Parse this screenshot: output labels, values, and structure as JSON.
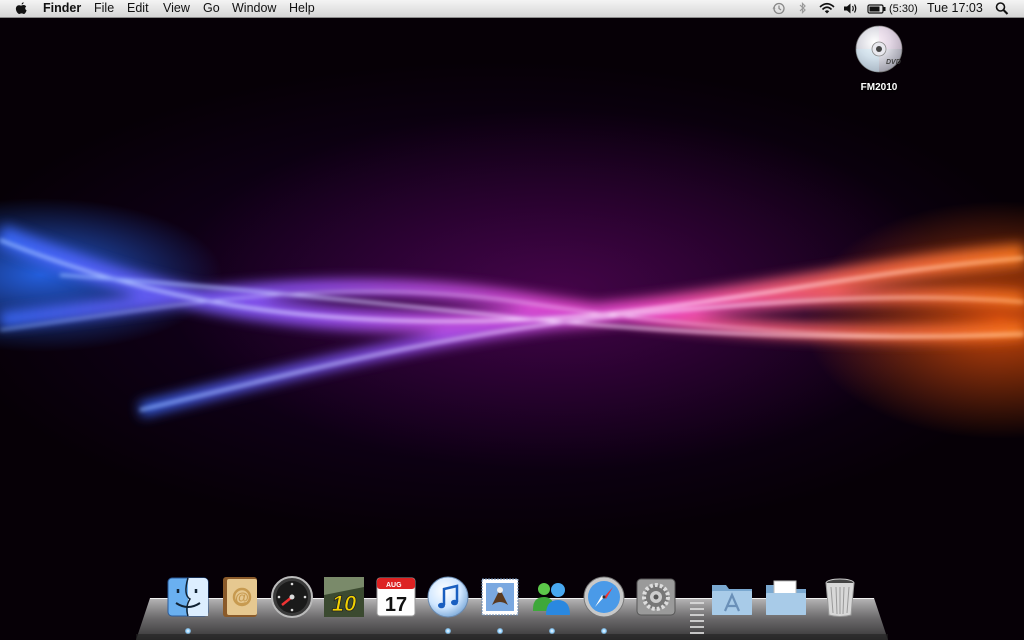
{
  "menubar": {
    "app_name": "Finder",
    "menus": [
      "File",
      "Edit",
      "View",
      "Go",
      "Window",
      "Help"
    ],
    "battery_time": "(5:30)",
    "clock": "Tue 17:03"
  },
  "desktop": {
    "disc_label": "FM2010",
    "disc_badge": "DVD"
  },
  "dock": {
    "items": [
      {
        "name": "Finder",
        "icon": "finder-icon"
      },
      {
        "name": "Address Book",
        "icon": "address-book-icon"
      },
      {
        "name": "Dashboard",
        "icon": "dashboard-icon"
      },
      {
        "name": "FM 10",
        "icon": "fm10-icon",
        "text": "10"
      },
      {
        "name": "iCal",
        "icon": "calendar-icon",
        "month": "AUG",
        "day": "17"
      },
      {
        "name": "iTunes",
        "icon": "itunes-icon"
      },
      {
        "name": "Mail",
        "icon": "mail-icon"
      },
      {
        "name": "Messenger",
        "icon": "messenger-icon"
      },
      {
        "name": "Safari",
        "icon": "safari-icon"
      },
      {
        "name": "System Preferences",
        "icon": "system-preferences-icon"
      },
      {
        "name": "Applications",
        "icon": "applications-folder-icon"
      },
      {
        "name": "Documents",
        "icon": "documents-folder-icon"
      },
      {
        "name": "Trash",
        "icon": "trash-icon"
      }
    ]
  }
}
